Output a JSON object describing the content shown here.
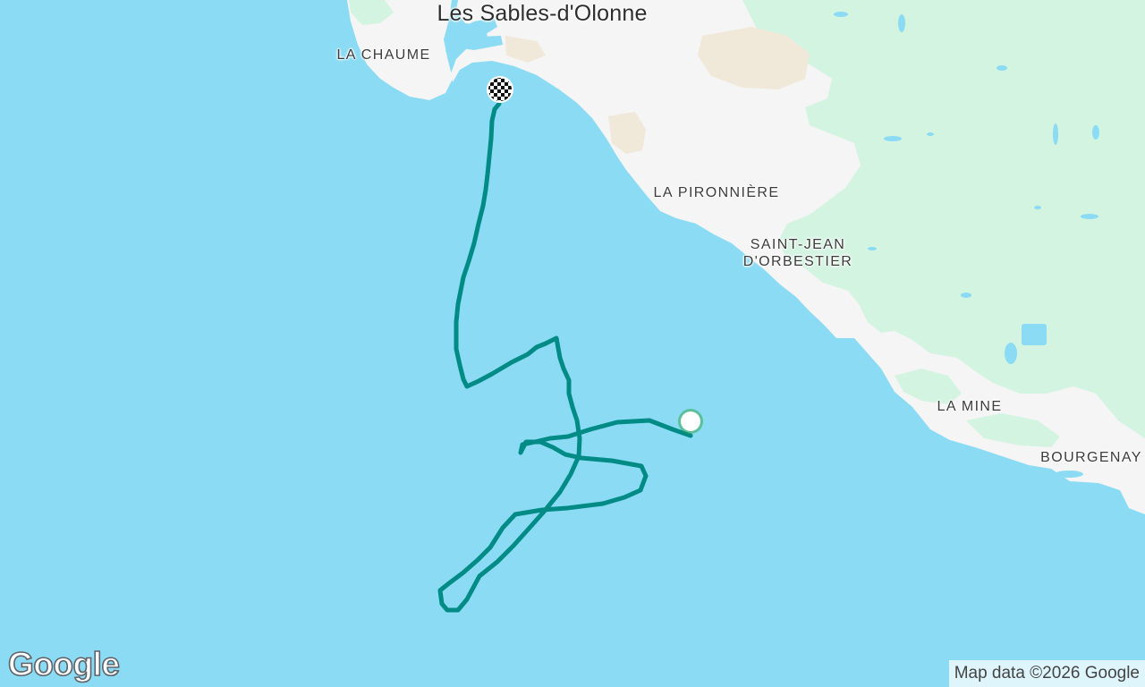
{
  "map": {
    "colors": {
      "water": "#8adbf3",
      "land": "#f5f5f5",
      "vegetation": "#d4f4e2",
      "sand": "#f0e8d8",
      "track": "#008b86"
    },
    "place_labels": {
      "city": "Les Sables-d'Olonne",
      "la_chaume": "LA CHAUME",
      "la_pironniere": "LA PIRONNIÈRE",
      "saint_jean_line1": "SAINT-JEAN",
      "saint_jean_line2": "D'ORBESTIER",
      "la_mine": "LA MINE",
      "bourgenay": "BOURGENAY"
    },
    "markers": {
      "start": "start-marker",
      "finish": "finish-flag-marker"
    },
    "logo_text": "Google",
    "attribution": "Map data ©2026 Google"
  }
}
